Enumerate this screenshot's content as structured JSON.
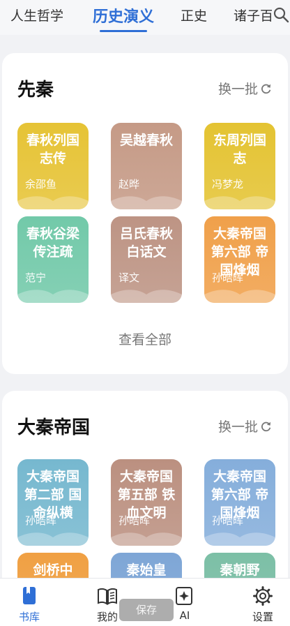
{
  "top_tabs": [
    "人生哲学",
    "历史演义",
    "正史",
    "诸子百"
  ],
  "sections": [
    {
      "title": "先秦",
      "refresh_label": "换一批",
      "view_all": "查看全部",
      "books": [
        {
          "title": "春秋列国志传",
          "author": "余邵鱼",
          "color": "#e6c335"
        },
        {
          "title": "吴越春秋",
          "author": "赵晔",
          "color": "#c59a86"
        },
        {
          "title": "东周列国志",
          "author": "冯梦龙",
          "color": "#e4c332"
        },
        {
          "title": "春秋谷梁传注疏",
          "author": "范宁",
          "color": "#72c9a9"
        },
        {
          "title": "吕氏春秋白话文",
          "author": "译文",
          "color": "#bd9484"
        },
        {
          "title": "大秦帝国第六部 帝国烽烟",
          "author": "孙皓晖",
          "color": "#f0a04a"
        }
      ]
    },
    {
      "title": "大秦帝国",
      "refresh_label": "换一批",
      "books": [
        {
          "title": "大秦帝国第二部 国命纵横",
          "author": "孙皓晖",
          "color": "#76b8cf"
        },
        {
          "title": "大秦帝国第五部 铁血文明",
          "author": "孙皓晖",
          "color": "#bb9080"
        },
        {
          "title": "大秦帝国第六部 帝国烽烟",
          "author": "孙皓晖",
          "color": "#85aedb"
        },
        {
          "title": "剑桥中",
          "author": "",
          "color": "#f0a043"
        },
        {
          "title": "秦始皇",
          "author": "",
          "color": "#7ea6d6"
        },
        {
          "title": "秦朝野",
          "author": "",
          "color": "#7cbfa6"
        }
      ]
    }
  ],
  "bottom_nav": [
    {
      "label": "书库",
      "icon": "bookmark-book-icon",
      "active": true
    },
    {
      "label": "我的",
      "icon": "open-book-icon",
      "active": false
    },
    {
      "label": "AI",
      "icon": "ai-sparkle-icon",
      "active": false
    },
    {
      "label": "设置",
      "icon": "gear-icon",
      "active": false
    }
  ],
  "save_overlay": "保存",
  "colors": {
    "accent": "#2f6fd6"
  }
}
